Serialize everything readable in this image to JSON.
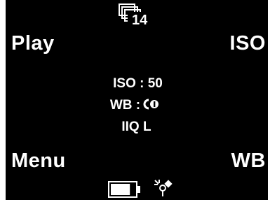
{
  "top": {
    "icon": "image-stack-icon",
    "count": "14"
  },
  "buttons": {
    "play": "Play",
    "iso": "ISO",
    "menu": "Menu",
    "wb": "WB"
  },
  "status": {
    "iso": "ISO : 50",
    "wb_prefix": "WB :",
    "wb_icon": "custom-wb-icon",
    "iq": "IIQ L"
  },
  "bottom": {
    "battery_icon": "battery-icon",
    "battery_level": 0.8,
    "connection_icon": "firewire-icon"
  },
  "colors": {
    "background": "#000000",
    "foreground": "#ffffff"
  }
}
